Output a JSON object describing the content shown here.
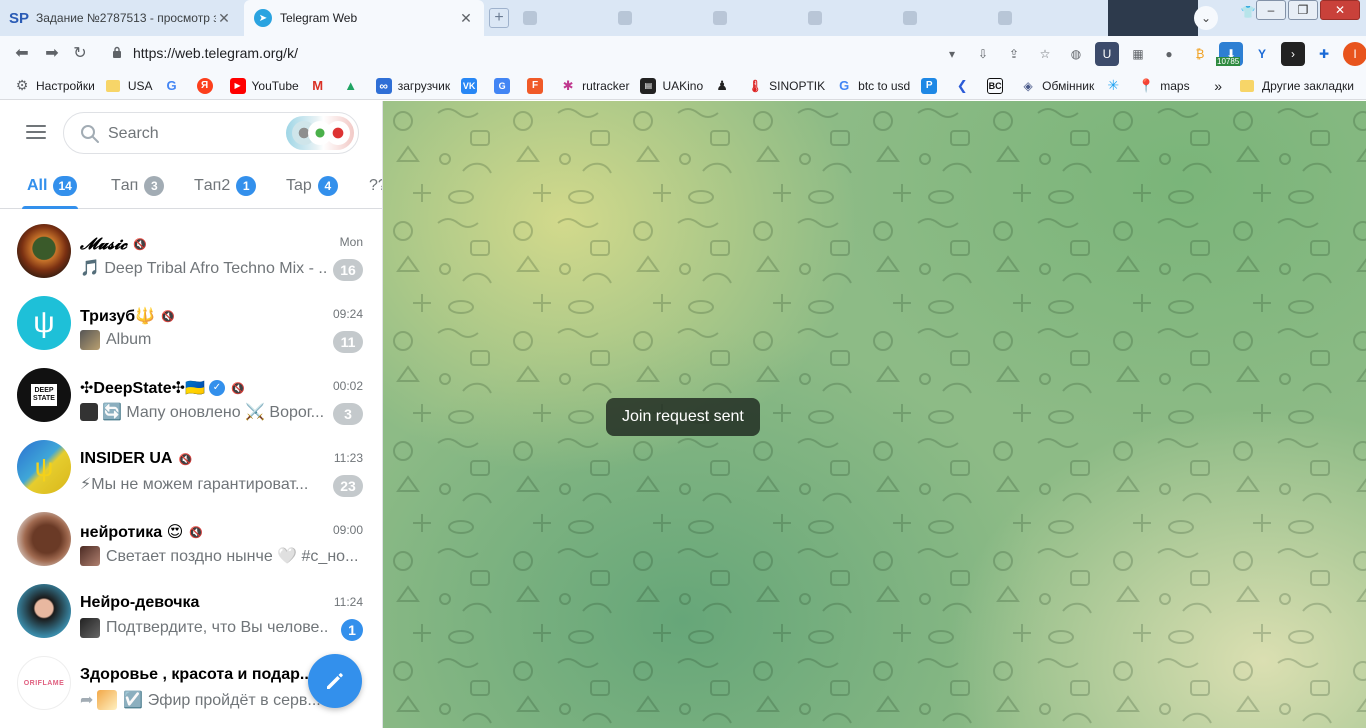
{
  "browser": {
    "tabs": [
      {
        "title": "Задание №2787513 - просмотр з",
        "favicon": "SP",
        "active": false
      },
      {
        "title": "Telegram Web",
        "favicon": "telegram-icon",
        "active": true
      }
    ],
    "url": "https://web.telegram.org/k/",
    "extension_badge": "10785",
    "profile_initial": "I",
    "bookmarks": [
      {
        "label": "Настройки",
        "icon": "gear-icon"
      },
      {
        "label": "USA",
        "icon": "folder-icon"
      },
      {
        "label": "",
        "icon": "google-icon"
      },
      {
        "label": "",
        "icon": "yandex-icon"
      },
      {
        "label": "YouTube",
        "icon": "youtube-icon"
      },
      {
        "label": "",
        "icon": "gmail-icon"
      },
      {
        "label": "",
        "icon": "drive-icon"
      },
      {
        "label": "загрузчик",
        "icon": "infinity-icon"
      },
      {
        "label": "",
        "icon": "vk-icon"
      },
      {
        "label": "",
        "icon": "translate-icon"
      },
      {
        "label": "",
        "icon": "f-icon"
      },
      {
        "label": "rutracker",
        "icon": "rutracker-icon"
      },
      {
        "label": "UAKino",
        "icon": "uakino-icon"
      },
      {
        "label": "",
        "icon": "pawn-icon"
      },
      {
        "label": "SINOPTIK",
        "icon": "thermometer-icon"
      },
      {
        "label": "btc to usd",
        "icon": "google-icon"
      },
      {
        "label": "",
        "icon": "p-icon"
      },
      {
        "label": "",
        "icon": "k-icon"
      },
      {
        "label": "",
        "icon": "bc-icon"
      },
      {
        "label": "Обмінник",
        "icon": "exchange-icon"
      },
      {
        "label": "",
        "icon": "snowflake-icon"
      },
      {
        "label": "maps",
        "icon": "maps-icon"
      }
    ],
    "bookmarks_overflow": "»",
    "other_bookmarks": "Другие закладки"
  },
  "telegram": {
    "search_placeholder": "Search",
    "folders": [
      {
        "label": "All",
        "count": "14",
        "active": true
      },
      {
        "label": "Tап",
        "count": "3",
        "active": false
      },
      {
        "label": "Tап2",
        "count": "1",
        "active": false
      },
      {
        "label": "Tap",
        "count": "4",
        "active": false
      },
      {
        "label": "??",
        "count": "",
        "active": false
      }
    ],
    "chats": [
      {
        "name": "𝓜𝓾𝓼𝓲𝓬",
        "muted": true,
        "time": "Mon",
        "message": "🎵 Deep Tribal Afro Techno Mix - ...",
        "unread": "16",
        "badge_muted": true
      },
      {
        "name": "Тризуб🔱",
        "muted": true,
        "time": "09:24",
        "message": "Album",
        "unread": "11",
        "badge_muted": true
      },
      {
        "name": "✣DeepState✣🇺🇦",
        "verified": true,
        "muted": true,
        "time": "00:02",
        "message": "🔄 Мапу оновлено ⚔️ Ворог...",
        "unread": "3",
        "badge_muted": true
      },
      {
        "name": "INSIDER UA",
        "muted": true,
        "time": "11:23",
        "message": "⚡Мы не можем гарантироват...",
        "unread": "23",
        "badge_muted": true
      },
      {
        "name": "нейротика 😍",
        "muted": true,
        "time": "09:00",
        "message": "Светает поздно нынче 🤍 #с_но...",
        "unread": "",
        "badge_muted": true
      },
      {
        "name": "Нейро-девочка",
        "muted": false,
        "time": "11:24",
        "message": "Подтвердите, что Вы челове...",
        "unread": "1",
        "badge_muted": false
      },
      {
        "name": "Здоровье , красота и подар...",
        "muted": false,
        "time": "",
        "message": "☑️ Эфир пройдёт в серв...",
        "unread": "",
        "badge_muted": true
      }
    ],
    "toast": "Join request sent",
    "accent_color": "#3390ec"
  }
}
